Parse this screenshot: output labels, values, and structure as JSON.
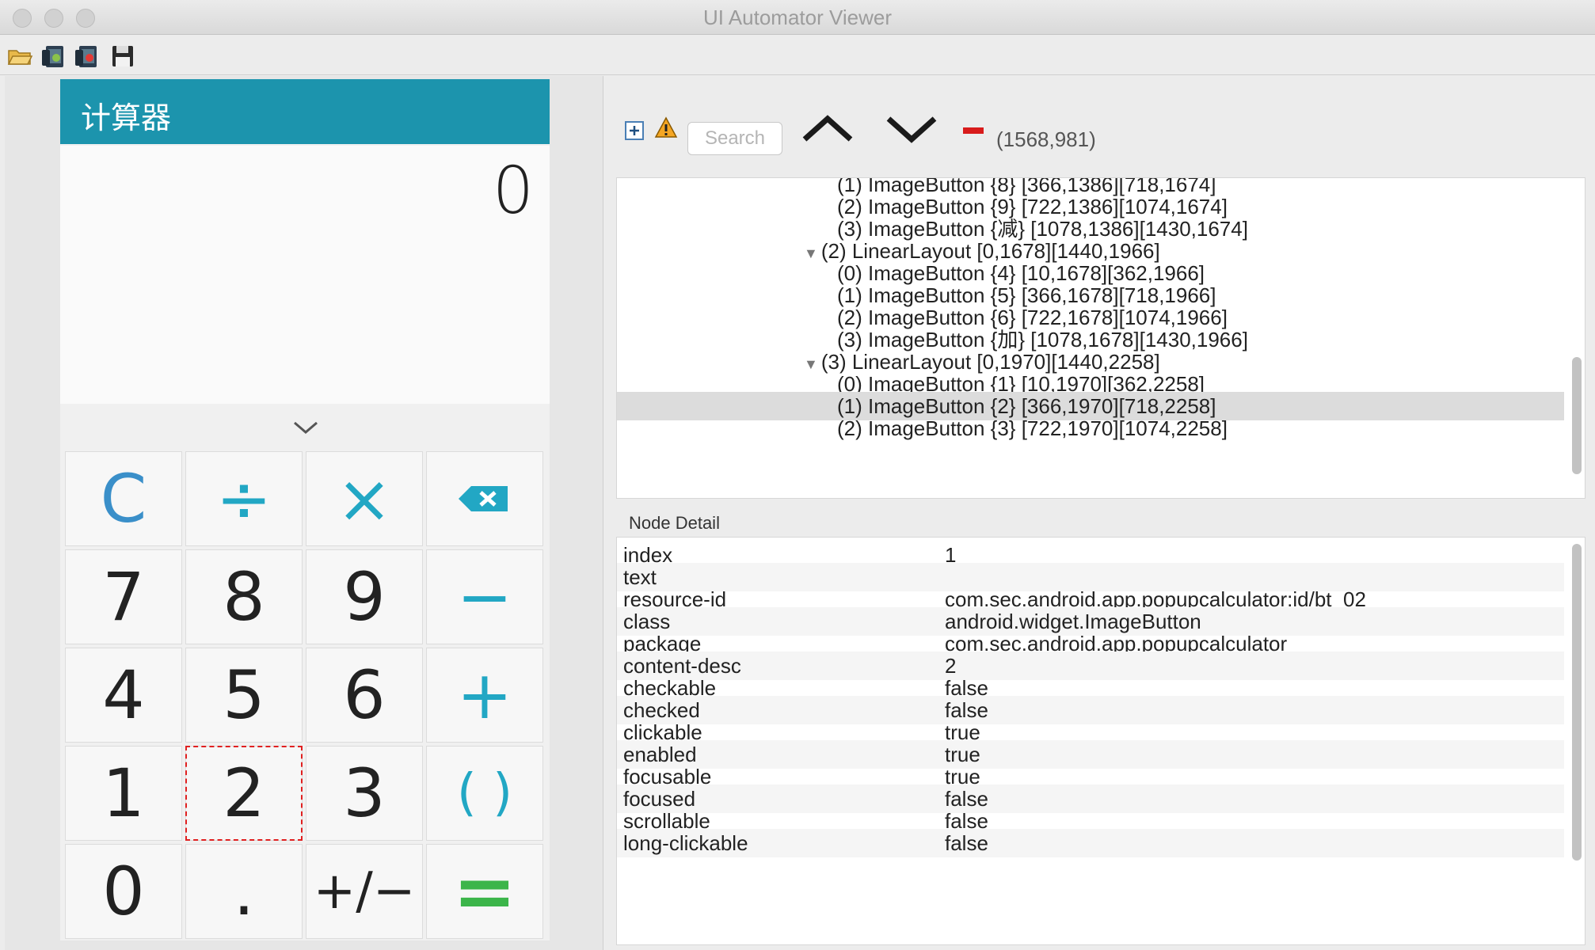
{
  "window": {
    "title": "UI Automator Viewer"
  },
  "toolbar": {
    "icons": [
      "open-folder-icon",
      "device-screenshot-icon",
      "device-screenshot-compressed-icon",
      "save-icon"
    ]
  },
  "device": {
    "app_title": "计算器",
    "display_value": "0",
    "keys": [
      {
        "label": "C",
        "color": "#3a8fc9",
        "icon": "clear"
      },
      {
        "label": "÷",
        "color": "#22a7c4",
        "icon": "divide"
      },
      {
        "label": "×",
        "color": "#22a7c4",
        "icon": "multiply"
      },
      {
        "label": "",
        "color": "#22a7c4",
        "icon": "backspace"
      },
      {
        "label": "7",
        "color": "#222222",
        "icon": ""
      },
      {
        "label": "8",
        "color": "#222222",
        "icon": ""
      },
      {
        "label": "9",
        "color": "#222222",
        "icon": ""
      },
      {
        "label": "−",
        "color": "#22a7c4",
        "icon": "minus"
      },
      {
        "label": "4",
        "color": "#222222",
        "icon": ""
      },
      {
        "label": "5",
        "color": "#222222",
        "icon": ""
      },
      {
        "label": "6",
        "color": "#222222",
        "icon": ""
      },
      {
        "label": "+",
        "color": "#22a7c4",
        "icon": "plus"
      },
      {
        "label": "1",
        "color": "#222222",
        "icon": ""
      },
      {
        "label": "2",
        "color": "#222222",
        "icon": ""
      },
      {
        "label": "3",
        "color": "#222222",
        "icon": ""
      },
      {
        "label": "( )",
        "color": "#22a7c4",
        "icon": "parentheses"
      },
      {
        "label": "0",
        "color": "#222222",
        "icon": ""
      },
      {
        "label": ".",
        "color": "#222222",
        "icon": ""
      },
      {
        "label": "+/−",
        "color": "#222222",
        "icon": "plus-minus"
      },
      {
        "label": "=",
        "color": "#3cb54a",
        "icon": "equals"
      }
    ],
    "selected_key": "2"
  },
  "inspector": {
    "search_placeholder": "Search",
    "coordinates": "(1568,981)",
    "tree_rows": [
      {
        "text": "(1) ImageButton {8} [366,1386][718,1674]",
        "level": 2,
        "arrow": ""
      },
      {
        "text": "(2) ImageButton {9} [722,1386][1074,1674]",
        "level": 2,
        "arrow": ""
      },
      {
        "text": "(3) ImageButton {减} [1078,1386][1430,1674]",
        "level": 2,
        "arrow": ""
      },
      {
        "text": "(2) LinearLayout [0,1678][1440,1966]",
        "level": 1,
        "arrow": "▼"
      },
      {
        "text": "(0) ImageButton {4} [10,1678][362,1966]",
        "level": 2,
        "arrow": ""
      },
      {
        "text": "(1) ImageButton {5} [366,1678][718,1966]",
        "level": 2,
        "arrow": ""
      },
      {
        "text": "(2) ImageButton {6} [722,1678][1074,1966]",
        "level": 2,
        "arrow": ""
      },
      {
        "text": "(3) ImageButton {加} [1078,1678][1430,1966]",
        "level": 2,
        "arrow": ""
      },
      {
        "text": "(3) LinearLayout [0,1970][1440,2258]",
        "level": 1,
        "arrow": "▼"
      },
      {
        "text": "(0) ImageButton {1} [10,1970][362,2258]",
        "level": 2,
        "arrow": ""
      },
      {
        "text": "(1) ImageButton {2} [366,1970][718,2258]",
        "level": 2,
        "arrow": "",
        "selected": true
      },
      {
        "text": "(2) ImageButton {3} [722,1970][1074,2258]",
        "level": 2,
        "arrow": ""
      }
    ],
    "detail_title": "Node Detail",
    "details": [
      {
        "key": "index",
        "value": "1"
      },
      {
        "key": "text",
        "value": ""
      },
      {
        "key": "resource-id",
        "value": "com.sec.android.app.popupcalculator:id/bt_02"
      },
      {
        "key": "class",
        "value": "android.widget.ImageButton"
      },
      {
        "key": "package",
        "value": "com.sec.android.app.popupcalculator"
      },
      {
        "key": "content-desc",
        "value": "2"
      },
      {
        "key": "checkable",
        "value": "false"
      },
      {
        "key": "checked",
        "value": "false"
      },
      {
        "key": "clickable",
        "value": "true"
      },
      {
        "key": "enabled",
        "value": "true"
      },
      {
        "key": "focusable",
        "value": "true"
      },
      {
        "key": "focused",
        "value": "false"
      },
      {
        "key": "scrollable",
        "value": "false"
      },
      {
        "key": "long-clickable",
        "value": "false"
      }
    ]
  }
}
